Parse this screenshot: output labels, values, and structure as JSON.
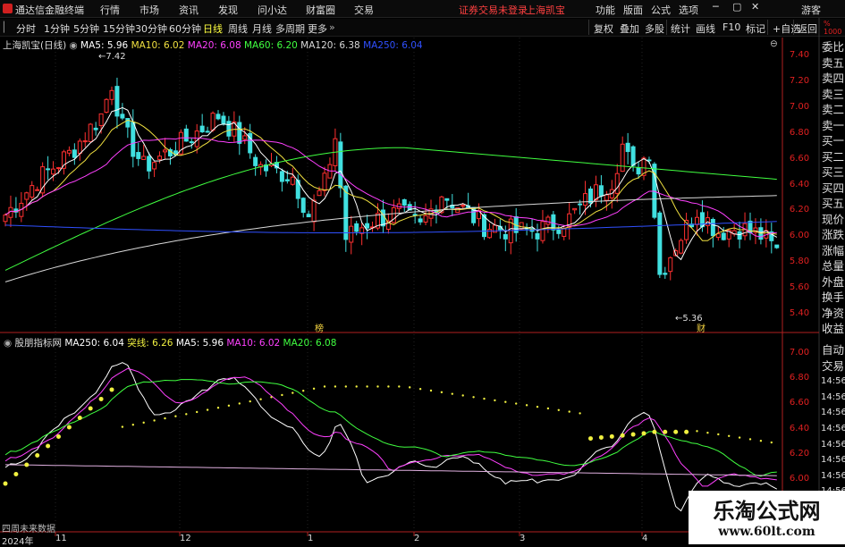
{
  "menu": {
    "app_title": "通达信金融终端",
    "items": [
      "行情",
      "市场",
      "资讯",
      "发现",
      "问小达",
      "财富圈",
      "交易"
    ],
    "notice": "证券交易未登录",
    "stock_name": "上海凯宝",
    "right_items": [
      "功能",
      "版面",
      "公式",
      "选项"
    ],
    "guest": "游客"
  },
  "toolbar": {
    "periods": [
      "分时",
      "1分钟",
      "5分钟",
      "15分钟",
      "30分钟",
      "60分钟",
      "日线",
      "周线",
      "月线",
      "多周期",
      "更多"
    ],
    "active_period": "日线",
    "right_buttons": [
      "复权",
      "叠加",
      "多股",
      "统计",
      "画线",
      "F10",
      "标记",
      "+自选",
      "返回"
    ]
  },
  "main_chart": {
    "title": "上海凯宝(日线)",
    "legend": [
      {
        "label": "MA5: 5.96",
        "color": "#ffffff"
      },
      {
        "label": "MA10: 6.02",
        "color": "#f0e040"
      },
      {
        "label": "MA20: 6.08",
        "color": "#ff40ff"
      },
      {
        "label": "MA60: 6.20",
        "color": "#40ff40"
      },
      {
        "label": "MA120: 6.38",
        "color": "#d8d8d8"
      },
      {
        "label": "MA250: 6.04",
        "color": "#3050ff"
      }
    ],
    "high_label": "7.42",
    "low_label": "5.36",
    "marker_left": "榜",
    "marker_right": "财"
  },
  "sub_chart": {
    "title": "股朋指标网",
    "legend": [
      {
        "label": "MA250: 6.04",
        "color": "#ffffff"
      },
      {
        "label": "突线: 6.26",
        "color": "#f0f040"
      },
      {
        "label": "MA5: 5.96",
        "color": "#ffffff"
      },
      {
        "label": "MA10: 6.02",
        "color": "#ff40ff"
      },
      {
        "label": "MA20: 6.08",
        "color": "#40ff40"
      }
    ],
    "footer_text": "四周未来数据"
  },
  "price_axis": [
    "7.40",
    "7.20",
    "7.00",
    "6.80",
    "6.60",
    "6.40",
    "6.20",
    "6.00",
    "5.80",
    "5.60",
    "5.40"
  ],
  "sub_axis": [
    "7.00",
    "6.80",
    "6.60",
    "6.40",
    "6.20",
    "6.00"
  ],
  "side_panel_main": [
    "委比",
    "卖五",
    "卖四",
    "卖三",
    "卖二",
    "卖一",
    "买一",
    "买二",
    "买三",
    "买四",
    "买五",
    "现价",
    "涨跌",
    "涨幅",
    "总量",
    "外盘",
    "换手",
    "净资",
    "收益"
  ],
  "side_panel_sub": [
    "自动",
    "交易",
    "14:56",
    "14:56",
    "14:56",
    "14:56",
    "14:56",
    "14:56",
    "14:56",
    "14:56",
    "14:56"
  ],
  "calendar": [
    "2024年",
    "11",
    "12",
    "1",
    "2",
    "3",
    "4"
  ],
  "watermark": {
    "title": "乐淘公式网",
    "url": "www.60lt.com"
  },
  "colors": {
    "up": "#ff3030",
    "down": "#40e0e0",
    "axis": "#e02020",
    "bg": "#000000"
  }
}
